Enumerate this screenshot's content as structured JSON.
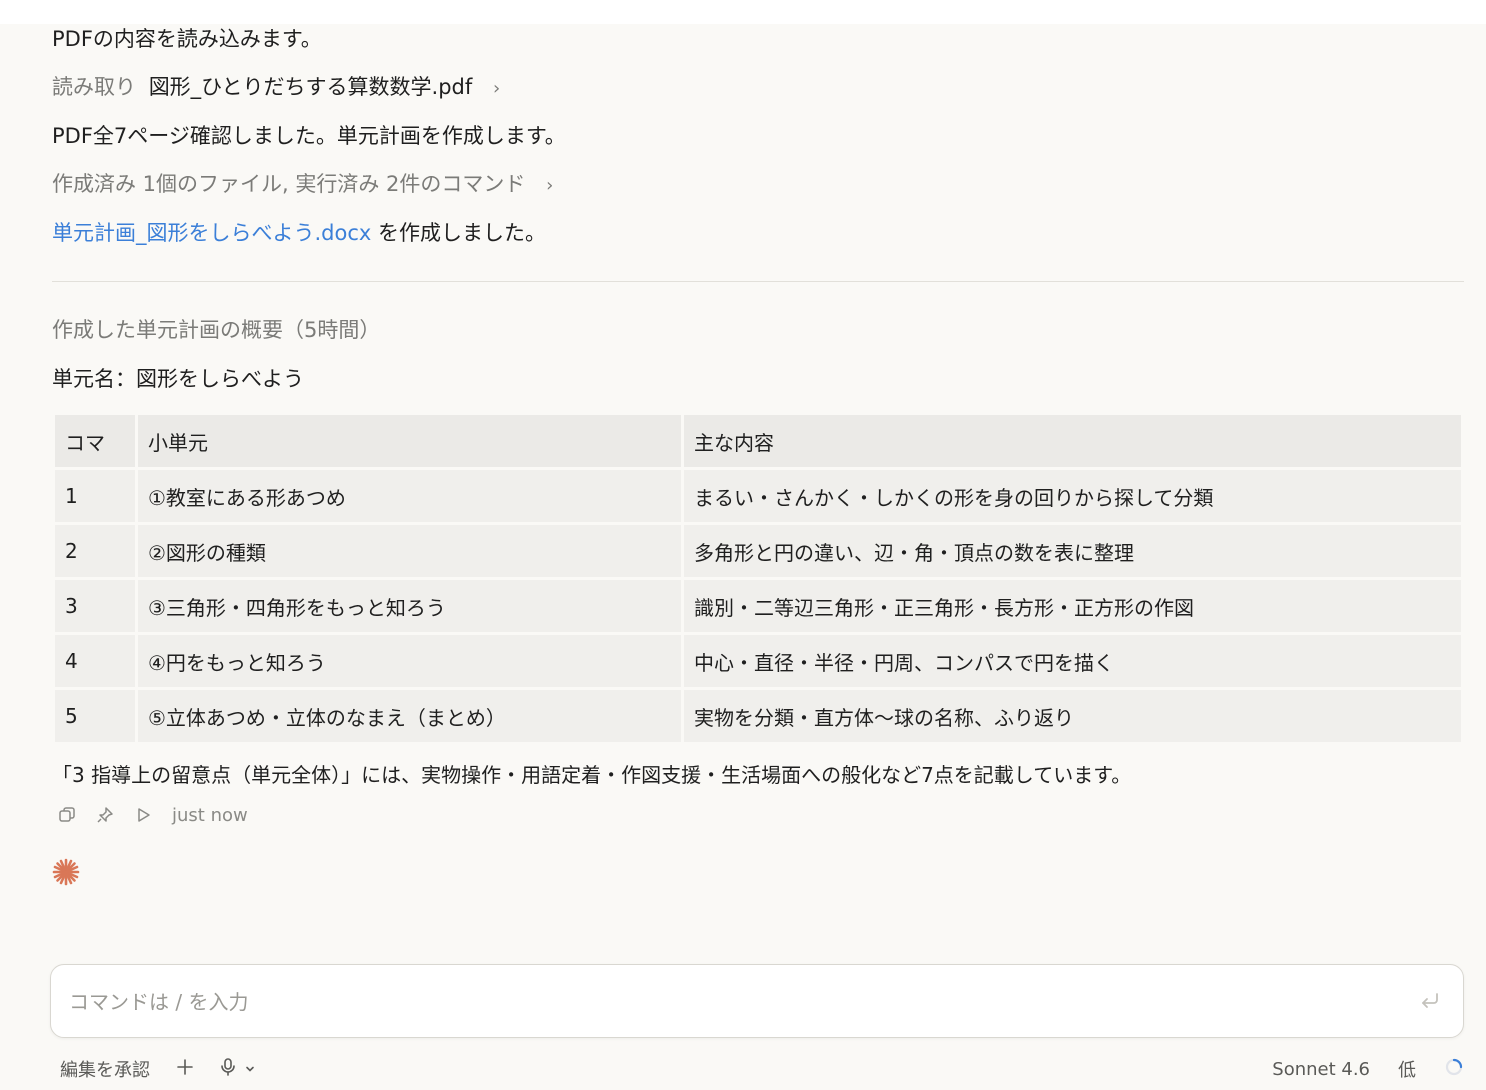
{
  "messages": {
    "line1": "PDFの内容を読み込みます。",
    "read_prefix": "読み取り",
    "read_file": "図形_ひとりだちする算数数学.pdf",
    "line3": "PDF全7ページ確認しました。単元計画を作成します。",
    "activity_summary": "作成済み 1個のファイル, 実行済み 2件のコマンド",
    "created_file_link": "単元計画_図形をしらべよう.docx",
    "created_suffix": " を作成しました。"
  },
  "summary": {
    "heading": "作成した単元計画の概要（5時間）",
    "unit_name": "単元名：図形をしらべよう",
    "table": {
      "headers": [
        "コマ",
        "小単元",
        "主な内容"
      ],
      "rows": [
        [
          "1",
          "①教室にある形あつめ",
          "まるい・さんかく・しかくの形を身の回りから探して分類"
        ],
        [
          "2",
          "②図形の種類",
          "多角形と円の違い、辺・角・頂点の数を表に整理"
        ],
        [
          "3",
          "③三角形・四角形をもっと知ろう",
          "識別・二等辺三角形・正三角形・長方形・正方形の作図"
        ],
        [
          "4",
          "④円をもっと知ろう",
          "中心・直径・半径・円周、コンパスで円を描く"
        ],
        [
          "5",
          "⑤立体あつめ・立体のなまえ（まとめ）",
          "実物を分類・直方体〜球の名称、ふり返り"
        ]
      ]
    },
    "note": "「3 指導上の留意点（単元全体）」には、実物操作・用語定着・作図支援・生活場面への般化など7点を記載しています。"
  },
  "message_actions": {
    "timestamp": "just now",
    "icons": [
      "copy-icon",
      "pin-icon",
      "play-icon"
    ]
  },
  "input": {
    "placeholder": "コマンドは / を入力",
    "value": ""
  },
  "bottom_bar": {
    "approve_edits": "編集を承認",
    "model": "Sonnet 4.6",
    "effort": "低"
  },
  "colors": {
    "accent_link": "#3b7fd8",
    "spark": "#d97757",
    "background": "#faf9f6"
  }
}
